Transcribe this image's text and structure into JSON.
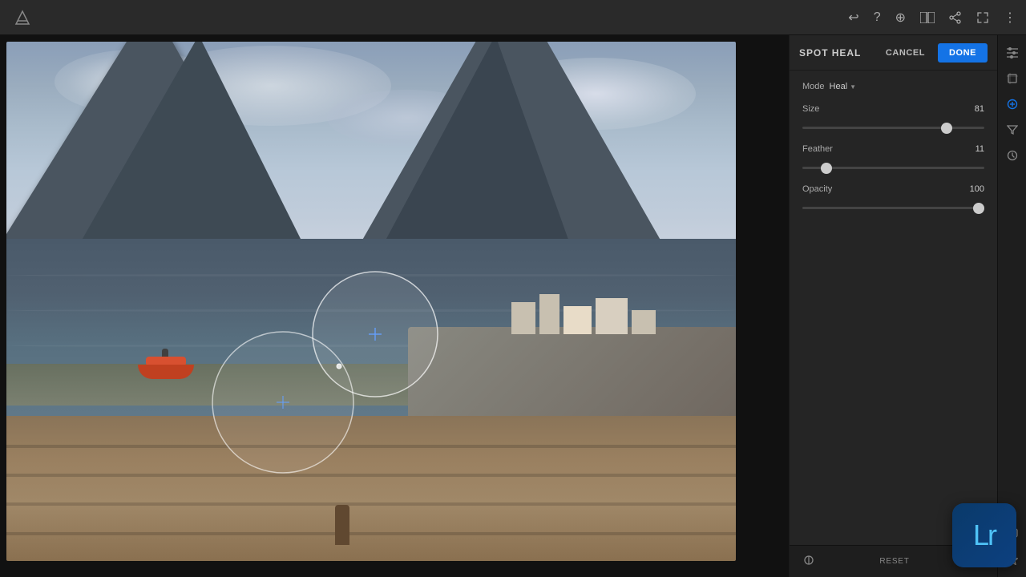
{
  "app": {
    "title": "Adobe Lightroom"
  },
  "topbar": {
    "undo_tooltip": "Undo",
    "help_tooltip": "Help",
    "add_tooltip": "Add",
    "compare_tooltip": "Compare",
    "share_tooltip": "Share",
    "fullscreen_tooltip": "Fullscreen",
    "more_tooltip": "More"
  },
  "panel": {
    "title": "SPOT HEAL",
    "cancel_label": "CANCEL",
    "done_label": "DONE",
    "mode_label": "Mode",
    "mode_value": "Heal",
    "size_label": "Size",
    "size_value": 81,
    "size_percent": 72,
    "feather_label": "Feather",
    "feather_value": 11,
    "feather_percent": 18,
    "opacity_label": "Opacity",
    "opacity_value": 100,
    "opacity_percent": 100
  },
  "bottom": {
    "reset_label": "RESET"
  },
  "lr_badge": {
    "text": "Lr"
  },
  "colors": {
    "accent_blue": "#1473e6",
    "lr_blue": "#4fc3f7"
  }
}
